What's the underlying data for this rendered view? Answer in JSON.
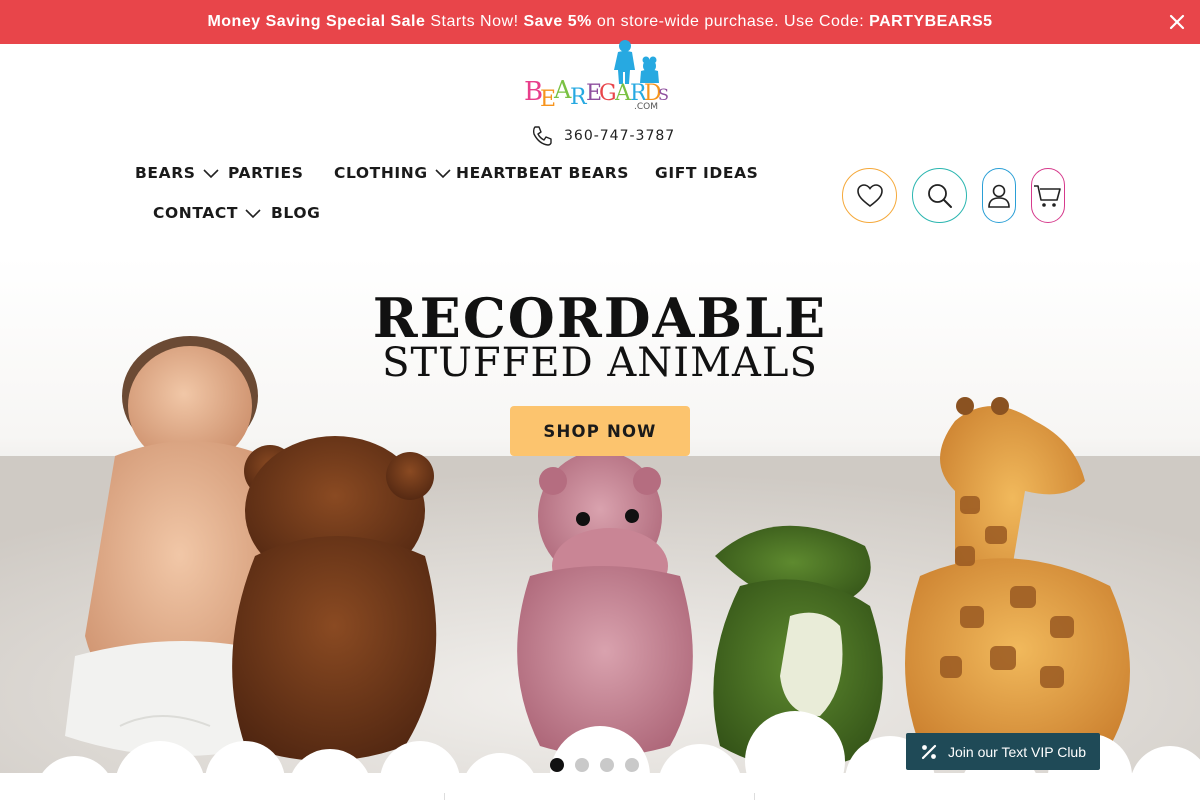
{
  "announcement": {
    "bold1": "Money Saving Special Sale",
    "text1": " Starts Now! ",
    "bold2": "Save 5%",
    "text2": " on store-wide purchase. Use Code: ",
    "code": "PARTYBEARS5",
    "close_icon": "close-icon",
    "bg_color": "#e8454a"
  },
  "logo": {
    "letters": [
      "B",
      "E",
      "A",
      "R",
      "E",
      "G",
      "A",
      "R",
      "D",
      "S"
    ],
    "suffix": ".COM"
  },
  "contact": {
    "phone": "360-747-3787",
    "icon": "phone-icon"
  },
  "nav": {
    "items": [
      {
        "label": "BEARS",
        "has_dropdown": true
      },
      {
        "label": "PARTIES",
        "has_dropdown": false
      },
      {
        "label": "CLOTHING",
        "has_dropdown": true
      },
      {
        "label": "HEARTBEAT BEARS",
        "has_dropdown": false
      },
      {
        "label": "GIFT IDEAS",
        "has_dropdown": false
      },
      {
        "label": "CONTACT",
        "has_dropdown": true
      },
      {
        "label": "BLOG",
        "has_dropdown": false
      }
    ]
  },
  "header_icons": [
    {
      "name": "heart-icon",
      "color": "#f5a93b"
    },
    {
      "name": "search-icon",
      "color": "#2bb6b0"
    },
    {
      "name": "account-icon",
      "color": "#2a9fd6"
    },
    {
      "name": "cart-icon",
      "color": "#d63a8c"
    }
  ],
  "hero": {
    "title_line1": "RECORDABLE",
    "title_line2": "STUFFED ANIMALS",
    "cta": "SHOP NOW",
    "cta_color": "#fcc46e"
  },
  "carousel": {
    "slides": 4,
    "active": 1
  },
  "vip": {
    "label": "Join our Text VIP Club",
    "icon": "percent-icon",
    "bg_color": "#1f4a57"
  }
}
